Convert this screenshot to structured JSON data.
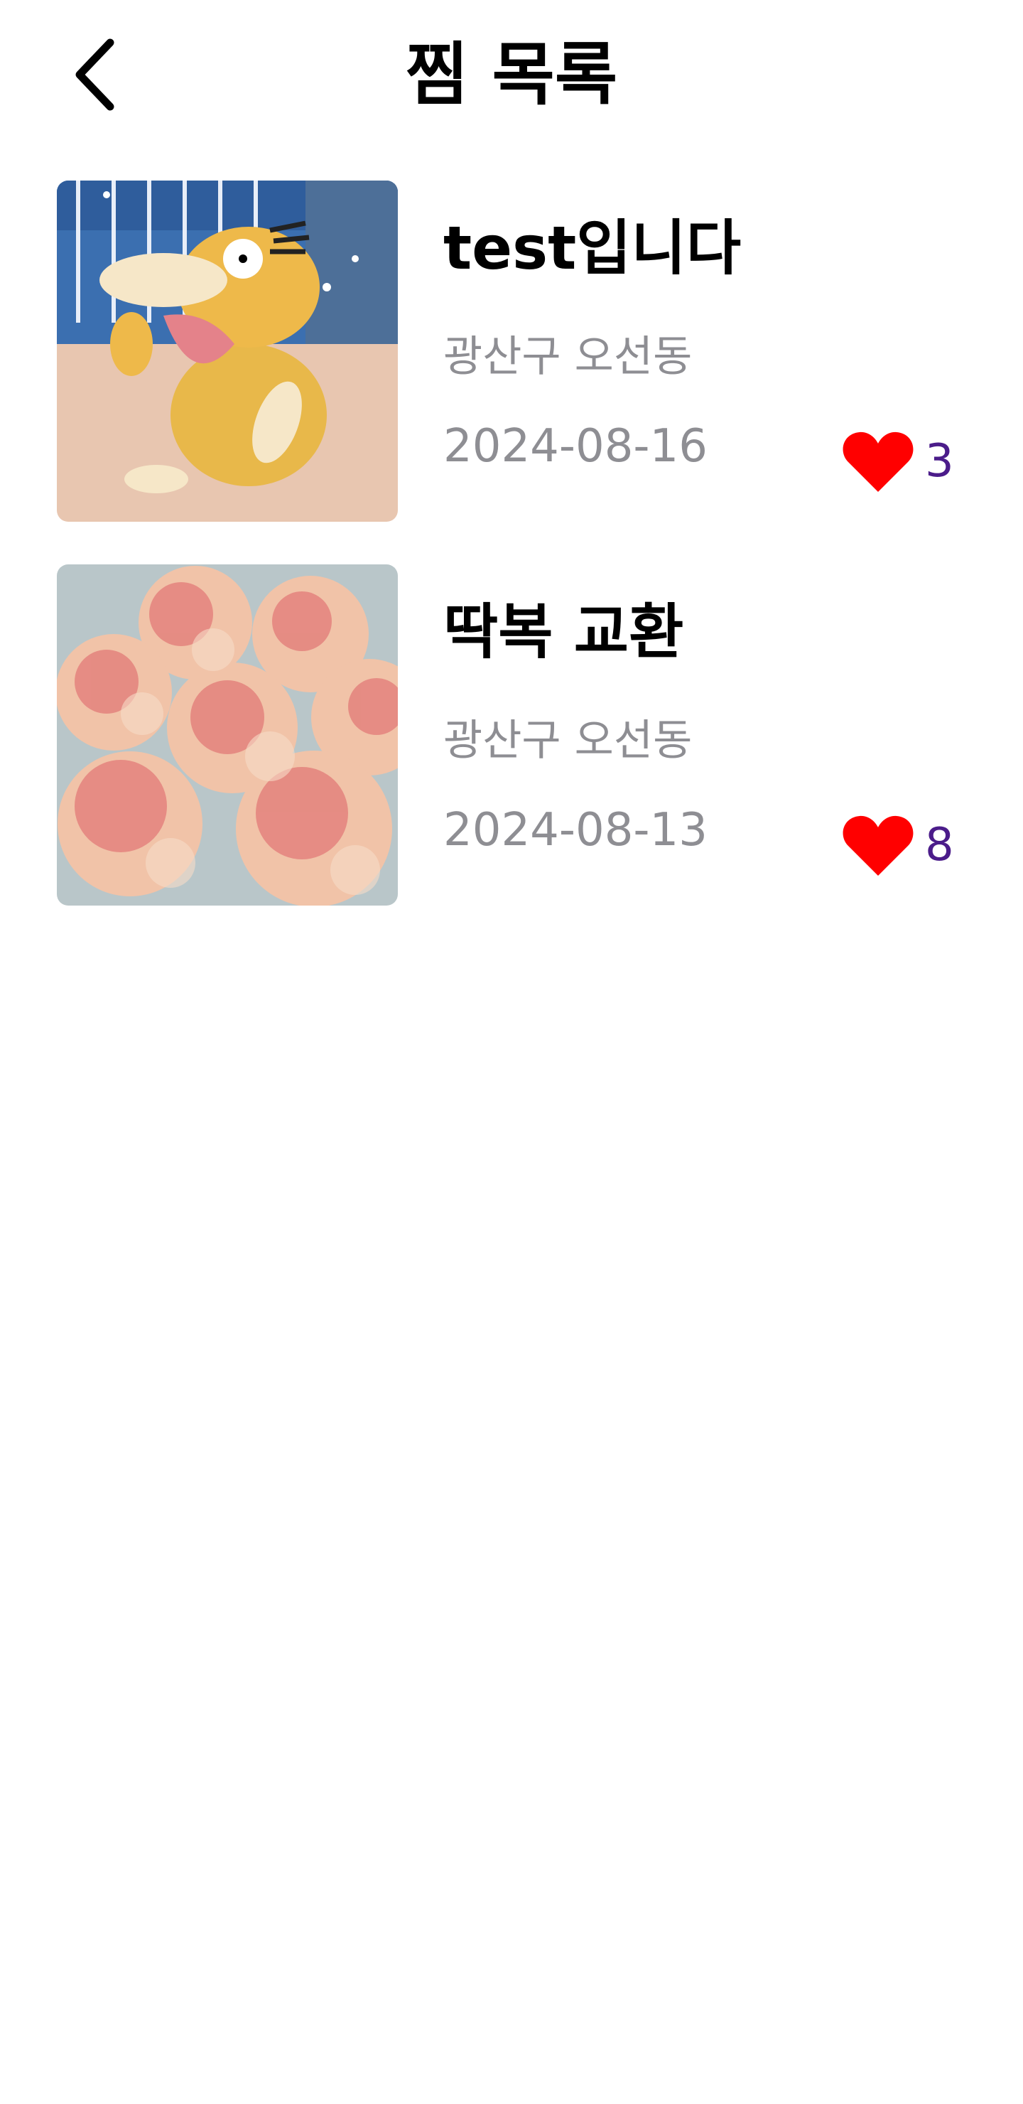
{
  "header": {
    "title": "찜 목록",
    "back_icon": "chevron-left-icon"
  },
  "colors": {
    "title_text": "#000000",
    "secondary_text": "#8e8e93",
    "heart": "#ff0000",
    "like_count": "#4b1c8a",
    "background": "#ffffff"
  },
  "items": [
    {
      "title": "test입니다",
      "location": "광산구 오선동",
      "date": "2024-08-16",
      "likes": "3",
      "image": "cartoon-duck-photo",
      "like_icon": "heart-icon"
    },
    {
      "title": "딱복 교환",
      "location": "광산구 오선동",
      "date": "2024-08-13",
      "likes": "8",
      "image": "peaches-photo",
      "like_icon": "heart-icon"
    }
  ]
}
